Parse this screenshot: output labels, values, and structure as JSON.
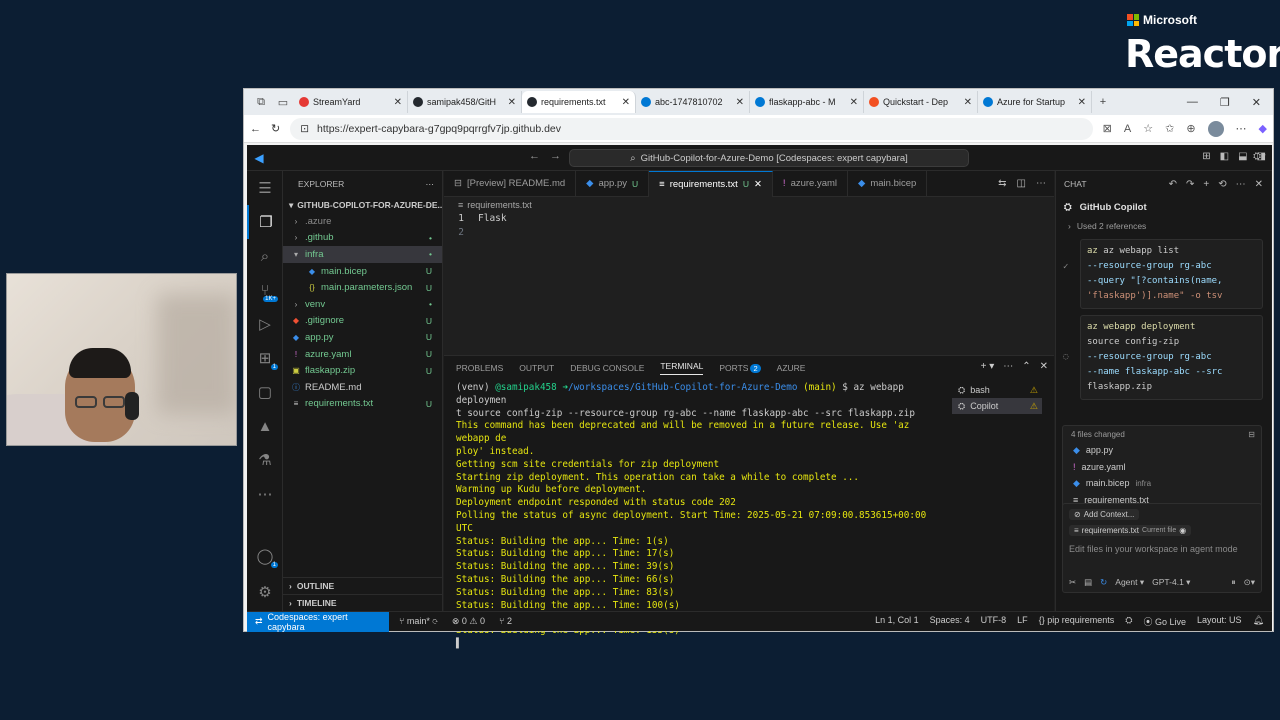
{
  "branding": {
    "company": "Microsoft",
    "product": "Reactor",
    "ms_colors": [
      "#f25022",
      "#7fba00",
      "#00a4ef",
      "#ffb900"
    ]
  },
  "browser": {
    "tabs": [
      {
        "label": "StreamYard",
        "color": "#e53935"
      },
      {
        "label": "samipak458/GitH",
        "color": "#24292f"
      },
      {
        "label": "requirements.txt",
        "color": "#24292f"
      },
      {
        "label": "abc-1747810702",
        "color": "#0078d4"
      },
      {
        "label": "flaskapp-abc - M",
        "color": "#0078d4"
      },
      {
        "label": "Quickstart - Dep",
        "color": "#f25022"
      },
      {
        "label": "Azure for Startup",
        "color": "#0078d4"
      }
    ],
    "url": "https://expert-capybara-g7gpq9pqrrgfv7jp.github.dev"
  },
  "vscode": {
    "command_center": "GitHub-Copilot-for-Azure-Demo [Codespaces: expert capybara]",
    "explorer": {
      "title": "EXPLORER",
      "root": "GITHUB-COPILOT-FOR-AZURE-DE...",
      "items": [
        {
          "name": ".azure",
          "status": "",
          "color": "#8b8b8b"
        },
        {
          "name": ".github",
          "status": "•",
          "color": "#73c991"
        },
        {
          "name": "infra",
          "status": "•",
          "color": "#73c991"
        },
        {
          "name": "main.bicep",
          "status": "U",
          "color": "#73c991"
        },
        {
          "name": "main.parameters.json",
          "status": "U",
          "color": "#73c991"
        },
        {
          "name": "venv",
          "status": "•",
          "color": "#73c991"
        },
        {
          "name": ".gitignore",
          "status": "U",
          "color": "#73c991"
        },
        {
          "name": "app.py",
          "status": "U",
          "color": "#73c991"
        },
        {
          "name": "azure.yaml",
          "status": "U",
          "color": "#73c991"
        },
        {
          "name": "flaskapp.zip",
          "status": "U",
          "color": "#73c991"
        },
        {
          "name": "README.md",
          "status": "",
          "color": "#cccccc"
        },
        {
          "name": "requirements.txt",
          "status": "U",
          "color": "#73c991"
        }
      ],
      "outline": "OUTLINE",
      "timeline": "TIMELINE"
    },
    "editor_tabs": [
      {
        "label": "[Preview] README.md",
        "mod": ""
      },
      {
        "label": "app.py",
        "mod": "U"
      },
      {
        "label": "requirements.txt",
        "mod": "U"
      },
      {
        "label": "azure.yaml",
        "mod": ""
      },
      {
        "label": "main.bicep",
        "mod": ""
      }
    ],
    "breadcrumb": "requirements.txt",
    "code": [
      {
        "ln": "1",
        "text": "Flask"
      },
      {
        "ln": "2",
        "text": ""
      }
    ],
    "panel_tabs": [
      "PROBLEMS",
      "OUTPUT",
      "DEBUG CONSOLE",
      "TERMINAL",
      "PORTS",
      "AZURE"
    ],
    "ports_badge": "2",
    "terminal": {
      "prompt_env": "(venv) ",
      "prompt_user": "@samipak458 ",
      "prompt_arrow": "➜",
      "prompt_path": "/workspaces/GitHub-Copilot-for-Azure-Demo ",
      "prompt_branch": "(main)",
      "prompt_cmd": " $ az webapp deploymen",
      "lines": [
        "t source config-zip --resource-group rg-abc --name flaskapp-abc --src flaskapp.zip",
        "This command has been deprecated and will be removed in a future release. Use 'az webapp de",
        "ploy' instead.",
        "Getting scm site credentials for zip deployment",
        "Starting zip deployment. This operation can take a while to complete ...",
        "Warming up Kudu before deployment.",
        "Deployment endpoint responded with status code 202",
        "Polling the status of async deployment. Start Time: 2025-05-21 07:09:00.853615+00:00 UTC",
        "Status: Building the app... Time: 1(s)",
        "Status: Building the app... Time: 17(s)",
        "Status: Building the app... Time: 39(s)",
        "Status: Building the app... Time: 66(s)",
        "Status: Building the app... Time: 83(s)",
        "Status: Building the app... Time: 100(s)",
        "Status: Building the app... Time: 118(s)",
        "Status: Building the app... Time: 135(s)"
      ],
      "sessions": [
        {
          "name": "bash"
        },
        {
          "name": "Copilot"
        }
      ]
    },
    "chat": {
      "title": "CHAT",
      "user": "GitHub Copilot",
      "refs": "Used 2 references",
      "block1": [
        "az webapp list",
        "--resource-group rg-abc",
        "--query \"[?contains(name,",
        "'flaskapp')].name\" -o tsv"
      ],
      "block2": [
        "az webapp deployment",
        "source config-zip",
        "--resource-group rg-abc",
        "--name flaskapp-abc --src",
        "flaskapp.zip"
      ],
      "files_changed": "4 files changed",
      "files": [
        {
          "name": "app.py",
          "sub": ""
        },
        {
          "name": "azure.yaml",
          "sub": ""
        },
        {
          "name": "main.bicep",
          "sub": "infra"
        },
        {
          "name": "requirements.txt",
          "sub": ""
        }
      ],
      "add_context": "Add Context...",
      "current_file": "requirements.txt",
      "current_file_tag": "Current file",
      "placeholder": "Edit files in your workspace in agent mode",
      "mode": "Agent",
      "model": "GPT-4.1"
    },
    "status": {
      "remote": "Codespaces: expert capybara",
      "branch": "main*",
      "problems": "0 ⚠ 0",
      "ports": "2",
      "position": "Ln 1, Col 1",
      "spaces": "Spaces: 4",
      "encoding": "UTF-8",
      "eol": "LF",
      "language": "pip requirements",
      "golive": "Go Live",
      "layout": "Layout: US"
    }
  }
}
